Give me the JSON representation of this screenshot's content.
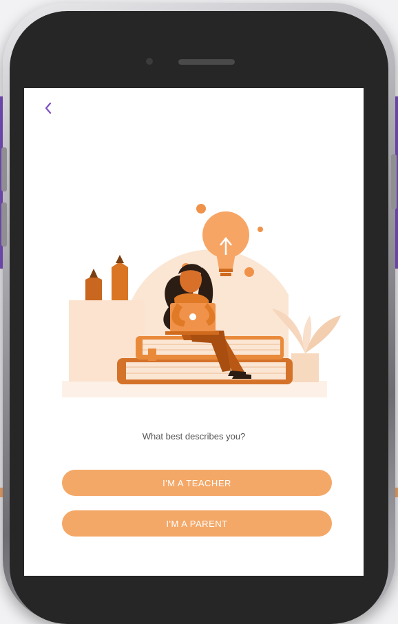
{
  "screen": {
    "back_icon": "chevron-left-icon",
    "question": "What best describes you?",
    "teacher_button": "I'M A TEACHER",
    "parent_button": "I'M A PARENT"
  },
  "colors": {
    "accent_purple": "#7d4fc4",
    "button_orange": "#f4a868",
    "illustration_orange": "#e07a26",
    "illustration_peach": "#fbe6d4"
  }
}
